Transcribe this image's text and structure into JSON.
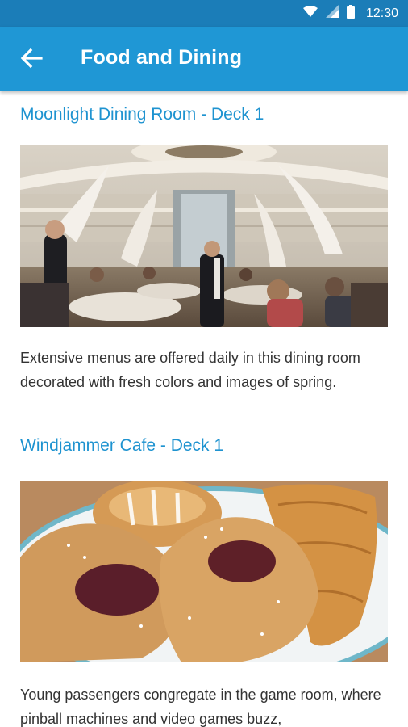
{
  "status_bar": {
    "time": "12:30",
    "icons": [
      "wifi-icon",
      "signal-icon",
      "battery-icon"
    ]
  },
  "app_bar": {
    "title": "Food and Dining",
    "back_icon": "arrow-back-icon",
    "background": "#1f97d5"
  },
  "sections": [
    {
      "title": "Moonlight Dining Room - Deck 1",
      "image": "dining-room-photo",
      "description": "Extensive menus are offered daily in this dining room decorated with fresh colors and images of spring."
    },
    {
      "title": "Windjammer Cafe - Deck 1",
      "image": "pastries-photo",
      "description": "Young passengers congregate in the game room, where pinball machines and video games buzz,"
    }
  ],
  "colors": {
    "status_bar": "#1b7db8",
    "accent": "#1e93d0",
    "body_text": "#333333"
  }
}
